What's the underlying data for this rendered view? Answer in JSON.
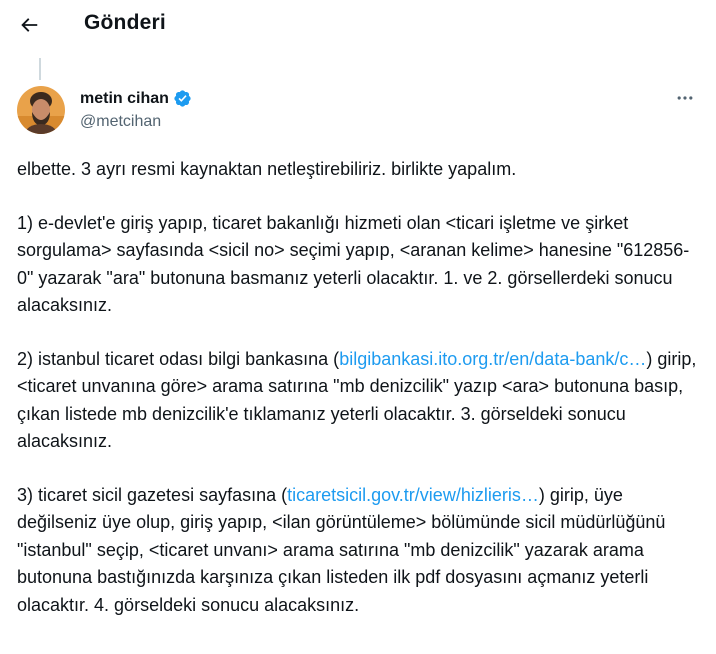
{
  "header": {
    "title": "Gönderi"
  },
  "author": {
    "name": "metin cihan",
    "handle": "@metcihan",
    "verified": true
  },
  "tweet": {
    "p1": "elbette. 3 ayrı resmi kaynaktan netleştirebiliriz. birlikte yapalım.",
    "p2": "1) e-devlet'e giriş yapıp, ticaret bakanlığı hizmeti olan <ticari işletme ve şirket sorgulama> sayfasında <sicil no> seçimi yapıp,  <aranan kelime> hanesine \"612856-0\" yazarak \"ara\" butonuna basmanız yeterli olacaktır. 1. ve 2. görsellerdeki sonucu alacaksınız.",
    "p3_before": "2) istanbul ticaret odası bilgi bankasına (",
    "p3_link": "bilgibankasi.ito.org.tr/en/data-bank/c…",
    "p3_after": ") girip, <ticaret unvanına göre> arama satırına \"mb denizcilik\" yazıp <ara> butonuna basıp, çıkan listede mb denizcilik'e tıklamanız yeterli olacaktır. 3. görseldeki sonucu alacaksınız.",
    "p4_before": "3) ticaret sicil gazetesi sayfasına (",
    "p4_link": "ticaretsicil.gov.tr/view/hizlieris…",
    "p4_after": ") girip, üye değilseniz üye olup, giriş yapıp, <ilan görüntüleme> bölümünde sicil müdürlüğünü \"istanbul\" seçip, <ticaret unvanı> arama satırına \"mb denizcilik\" yazarak arama butonuna bastığınızda karşınıza çıkan listeden ilk pdf dosyasını açmanız yeterli olacaktır. 4. görseldeki sonucu alacaksınız."
  },
  "colors": {
    "link": "#1d9bf0",
    "text": "#0f1419",
    "secondary": "#536471",
    "verified": "#1d9bf0"
  },
  "icons": {
    "back": "back-arrow-icon",
    "verified": "verified-badge-icon",
    "more": "more-horizontal-icon"
  }
}
